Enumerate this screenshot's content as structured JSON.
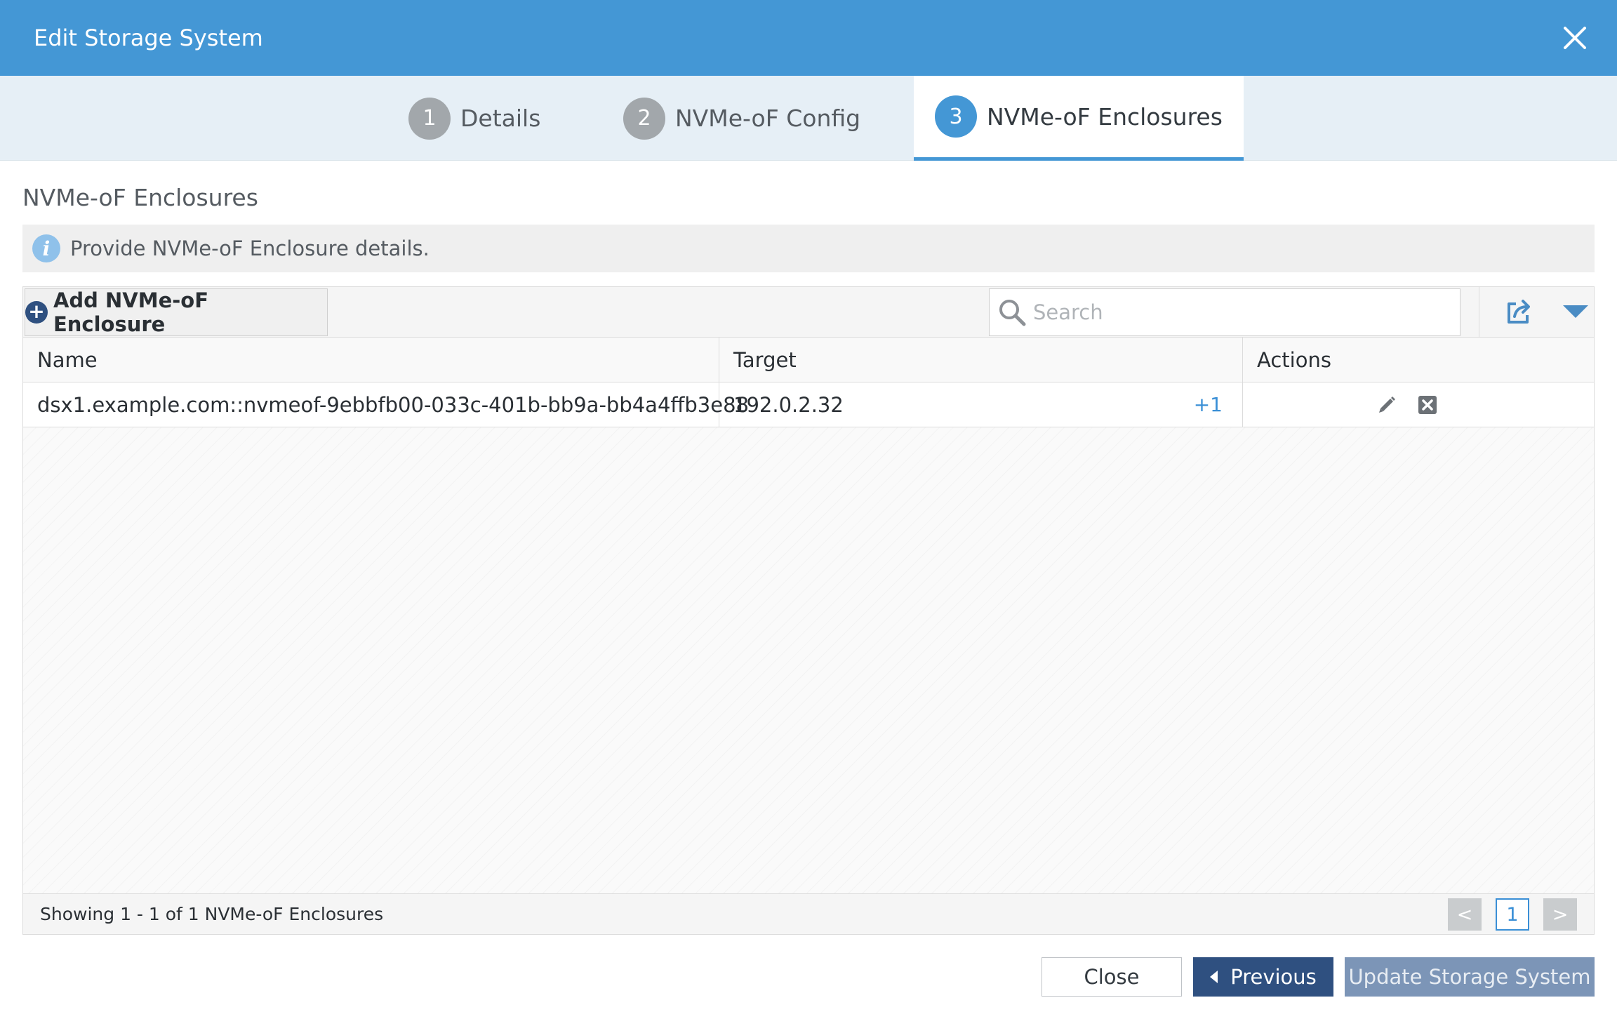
{
  "dialog": {
    "title": "Edit Storage System",
    "colors": {
      "header": "#4497d5",
      "primary_button": "#2f5080",
      "link": "#3a8fd6"
    }
  },
  "wizard": {
    "steps": [
      {
        "number": "1",
        "label": "Details",
        "state": "complete"
      },
      {
        "number": "2",
        "label": "NVMe-oF Config",
        "state": "complete"
      },
      {
        "number": "3",
        "label": "NVMe-oF Enclosures",
        "state": "active"
      }
    ]
  },
  "section": {
    "title": "NVMe-oF Enclosures",
    "info": "Provide NVMe-oF Enclosure details."
  },
  "grid": {
    "add_button": "Add NVMe-oF Enclosure",
    "search_placeholder": "Search",
    "columns": [
      "Name",
      "Target",
      "Actions"
    ],
    "rows": [
      {
        "name": "dsx1.example.com::nvmeof-9ebbfb00-033c-401b-bb9a-bb4a4ffb3e88",
        "target": "192.0.2.32",
        "target_more": "+1",
        "actions": [
          "pencil-icon",
          "delete-icon"
        ]
      }
    ],
    "footer": {
      "showing": "Showing 1 - 1 of 1 NVMe-oF Enclosures",
      "prev": "<",
      "page": "1",
      "next": ">"
    }
  },
  "buttons": {
    "close": "Close",
    "previous": "Previous",
    "update": "Update Storage System"
  }
}
